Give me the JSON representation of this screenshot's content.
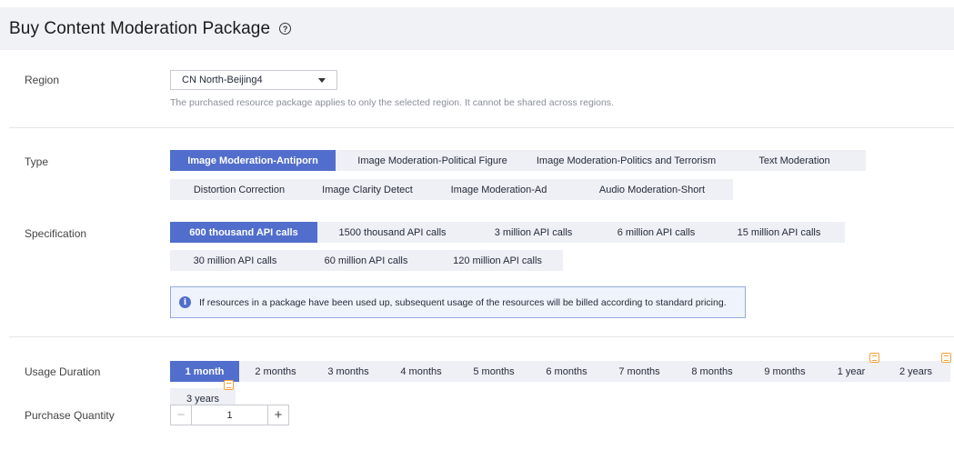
{
  "header": {
    "title": "Buy Content Moderation Package",
    "help_icon": "question-circle-icon"
  },
  "region": {
    "label": "Region",
    "selected": "CN North-Beijing4",
    "hint": "The purchased resource package applies to only the selected region. It cannot be shared across regions."
  },
  "type": {
    "label": "Type",
    "options": [
      "Image Moderation-Antiporn",
      "Image Moderation-Political Figure",
      "Image Moderation-Politics and Terrorism",
      "Text Moderation",
      "Distortion Correction",
      "Image Clarity Detect",
      "Image Moderation-Ad",
      "Audio Moderation-Short"
    ],
    "selected_index": 0
  },
  "specification": {
    "label": "Specification",
    "options": [
      "600 thousand API calls",
      "1500 thousand API calls",
      "3 million API calls",
      "6 million API calls",
      "15 million API calls",
      "30 million API calls",
      "60 million API calls",
      "120 million API calls"
    ],
    "selected_index": 0,
    "notice": "If resources in a package have been used up, subsequent usage of the resources will be billed according to standard pricing."
  },
  "duration": {
    "label": "Usage Duration",
    "options": [
      "1 month",
      "2 months",
      "3 months",
      "4 months",
      "5 months",
      "6 months",
      "7 months",
      "8 months",
      "9 months",
      "1 year",
      "2 years",
      "3 years"
    ],
    "selected_index": 0,
    "discount_icon": "discount-tag-icon"
  },
  "quantity": {
    "label": "Purchase Quantity",
    "value": "1",
    "minus": "−",
    "plus": "+"
  },
  "colors": {
    "accent": "#526ecc",
    "option_bg": "#eef0f5",
    "badge": "#f6a13a"
  }
}
